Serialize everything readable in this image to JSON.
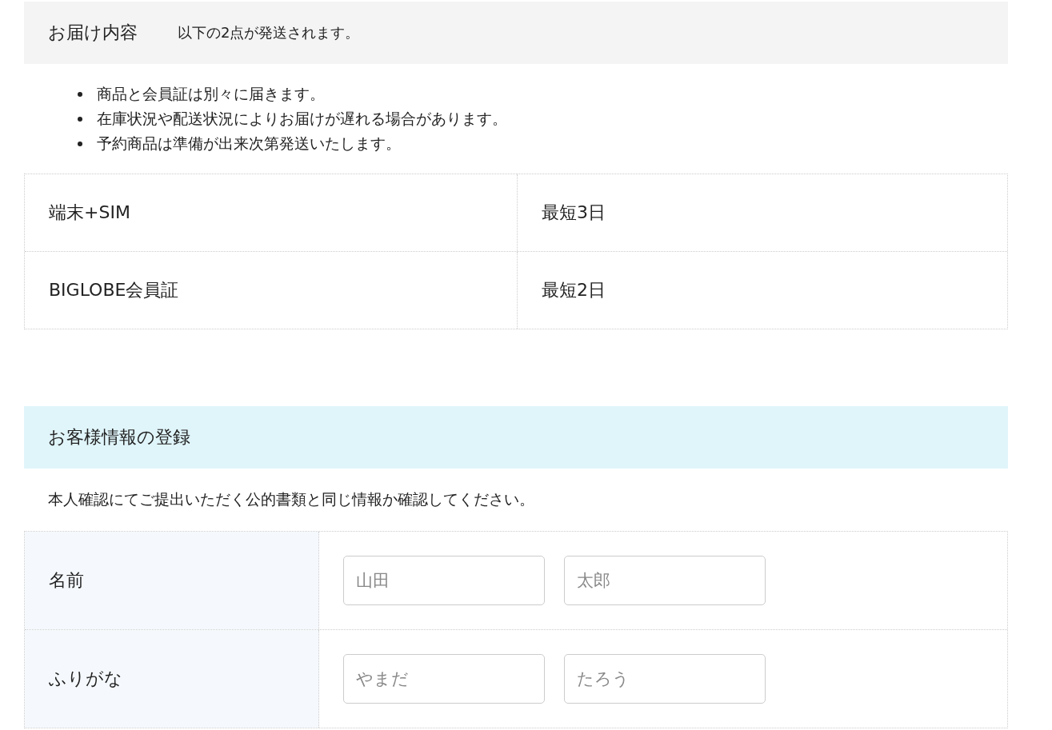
{
  "delivery": {
    "title": "お届け内容",
    "subtitle": "以下の2点が発送されます。",
    "notes": [
      "商品と会員証は別々に届きます。",
      "在庫状況や配送状況によりお届けが遅れる場合があります。",
      "予約商品は準備が出来次第発送いたします。"
    ],
    "rows": [
      {
        "item": "端末+SIM",
        "eta": "最短3日"
      },
      {
        "item": "BIGLOBE会員証",
        "eta": "最短2日"
      }
    ]
  },
  "customer": {
    "title": "お客様情報の登録",
    "description": "本人確認にてご提出いただく公的書類と同じ情報か確認してください。",
    "fields": [
      {
        "label": "名前",
        "inputs": [
          {
            "placeholder": "山田"
          },
          {
            "placeholder": "太郎"
          }
        ]
      },
      {
        "label": "ふりがな",
        "inputs": [
          {
            "placeholder": "やまだ"
          },
          {
            "placeholder": "たろう"
          }
        ]
      }
    ]
  }
}
